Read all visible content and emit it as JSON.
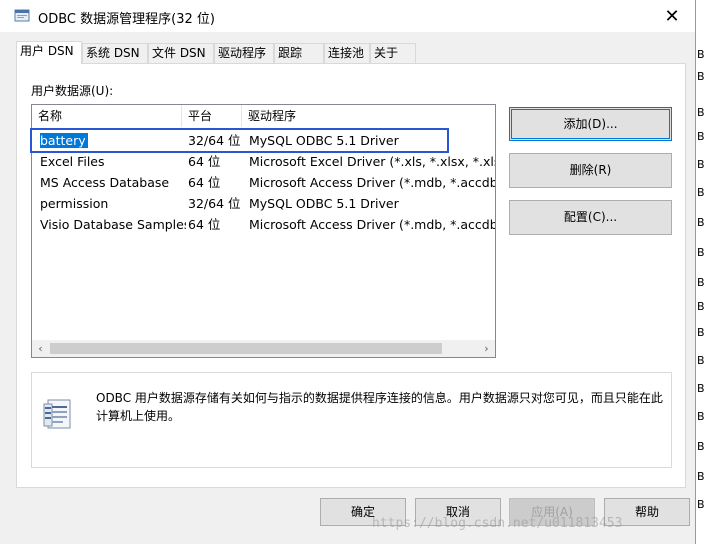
{
  "window": {
    "title": "ODBC 数据源管理程序(32 位)"
  },
  "tabs": [
    {
      "label": "用户 DSN"
    },
    {
      "label": "系统 DSN"
    },
    {
      "label": "文件 DSN"
    },
    {
      "label": "驱动程序"
    },
    {
      "label": "跟踪"
    },
    {
      "label": "连接池"
    },
    {
      "label": "关于"
    }
  ],
  "user_dsn": {
    "caption": "用户数据源(U):",
    "columns": [
      "名称",
      "平台",
      "驱动程序"
    ],
    "rows": [
      {
        "name": "battery",
        "platform": "32/64 位",
        "driver": "MySQL ODBC 5.1 Driver"
      },
      {
        "name": "Excel Files",
        "platform": "64 位",
        "driver": "Microsoft Excel Driver (*.xls, *.xlsx, *.xlsm, *"
      },
      {
        "name": "MS Access Database",
        "platform": "64 位",
        "driver": "Microsoft Access Driver (*.mdb, *.accdb)"
      },
      {
        "name": "permission",
        "platform": "32/64 位",
        "driver": "MySQL ODBC 5.1 Driver"
      },
      {
        "name": "Visio Database Samples",
        "platform": "64 位",
        "driver": "Microsoft Access Driver (*.mdb, *.accdb)"
      }
    ],
    "selected_index": 0
  },
  "side_buttons": {
    "add": "添加(D)...",
    "remove": "删除(R)",
    "configure": "配置(C)..."
  },
  "info": {
    "text": "ODBC 用户数据源存储有关如何与指示的数据提供程序连接的信息。用户数据源只对您可见，而且只能在此计算机上使用。"
  },
  "bottom_buttons": {
    "ok": "确定",
    "cancel": "取消",
    "apply": "应用(A)",
    "help": "帮助"
  },
  "watermark": "https://blog.csdn.net/u011813453"
}
